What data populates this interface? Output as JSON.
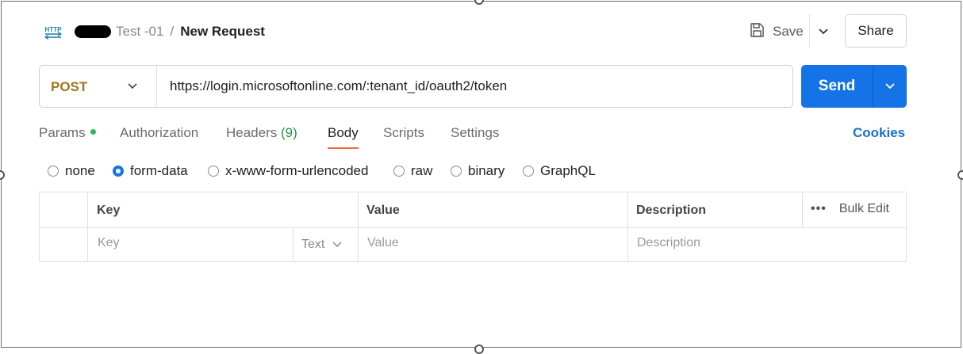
{
  "header": {
    "icon": "http-icon",
    "breadcrumb_parent": "Test -01",
    "breadcrumb_separator": "/",
    "title": "New Request",
    "save_label": "Save",
    "share_label": "Share"
  },
  "request": {
    "method": "POST",
    "url": "https://login.microsoftonline.com/:tenant_id/oauth2/token",
    "send_label": "Send"
  },
  "tabs": [
    {
      "label": "Params"
    },
    {
      "label": "Authorization"
    },
    {
      "label": "Headers",
      "count": "(9)"
    },
    {
      "label": "Body",
      "active": true
    },
    {
      "label": "Scripts"
    },
    {
      "label": "Settings"
    }
  ],
  "cookies_label": "Cookies",
  "body_types": [
    {
      "label": "none",
      "selected": false
    },
    {
      "label": "form-data",
      "selected": true
    },
    {
      "label": "x-www-form-urlencoded",
      "selected": false
    },
    {
      "label": "raw",
      "selected": false
    },
    {
      "label": "binary",
      "selected": false
    },
    {
      "label": "GraphQL",
      "selected": false
    }
  ],
  "table": {
    "headers": {
      "key": "Key",
      "value": "Value",
      "description": "Description",
      "bulk_edit": "Bulk Edit"
    },
    "row": {
      "key_placeholder": "Key",
      "type": "Text",
      "value_placeholder": "Value",
      "description_placeholder": "Description"
    }
  },
  "colors": {
    "accent": "#1473e6",
    "method": "#a0761a",
    "active_tab_underline": "#f26b3a",
    "params_dot": "#2db85c",
    "cookies": "#1a6fcf"
  }
}
